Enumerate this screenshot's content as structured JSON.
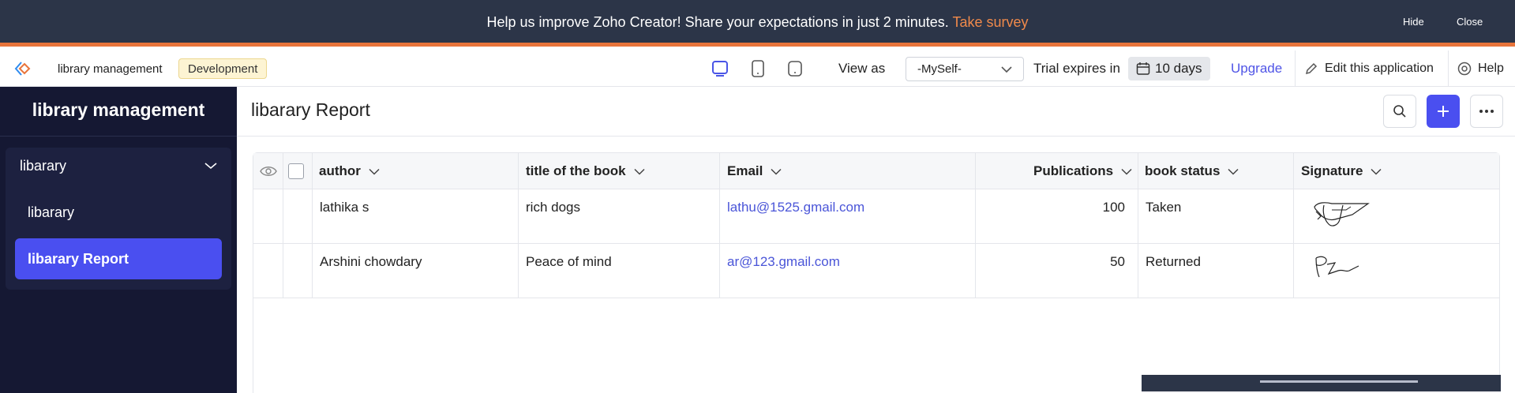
{
  "banner": {
    "message": "Help us improve Zoho Creator! Share your expectations in just 2 minutes.",
    "link": "Take survey",
    "hide": "Hide",
    "close": "Close",
    "accent": "#e8743b"
  },
  "toolbar": {
    "app_name": "library management",
    "environment": "Development",
    "view_as_label": "View as",
    "view_as_value": "-MySelf-",
    "trial_label": "Trial expires in",
    "trial_days": "10 days",
    "upgrade": "Upgrade",
    "edit": "Edit this application",
    "help": "Help",
    "icons": [
      "zoho-creator-logo-icon",
      "desktop-icon",
      "tablet-icon",
      "mobile-icon",
      "calendar-icon",
      "pencil-icon",
      "help-icon"
    ]
  },
  "sidebar": {
    "title": "library management",
    "group": "libarary",
    "items": [
      {
        "label": "libarary",
        "active": false
      },
      {
        "label": "libarary Report",
        "active": true
      }
    ],
    "background": "#151833",
    "active_color": "#4a4ff0"
  },
  "report": {
    "title": "libarary Report",
    "columns": [
      "author",
      "title of the book",
      "Email",
      "Publications",
      "book status",
      "Signature"
    ],
    "rows": [
      {
        "author": "lathika s",
        "title": "rich dogs",
        "email": "lathu@1525.gmail.com",
        "publications": "100",
        "status": "Taken"
      },
      {
        "author": "Arshini chowdary",
        "title": "Peace of mind",
        "email": "ar@123.gmail.com",
        "publications": "50",
        "status": "Returned"
      }
    ]
  }
}
